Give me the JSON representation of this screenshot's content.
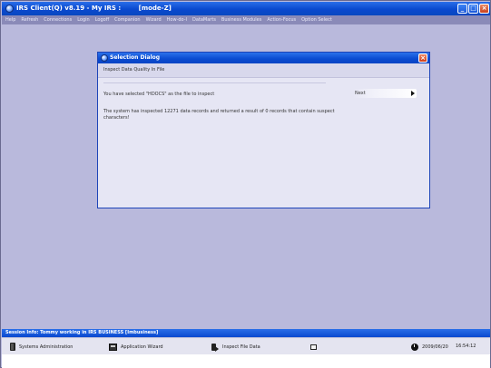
{
  "window": {
    "title": "IRS Client(Q) v8.19 - My IRS :        [mode-Z]",
    "minimize": "_",
    "maximize": "□",
    "close": "×"
  },
  "menu": {
    "items": [
      {
        "label": "Help"
      },
      {
        "label": "Refresh"
      },
      {
        "label": "Connections"
      },
      {
        "label": "Login"
      },
      {
        "label": "Logoff"
      },
      {
        "label": "Companion"
      },
      {
        "label": "Wizard"
      },
      {
        "label": "How-do-I"
      },
      {
        "label": "DataMarts"
      },
      {
        "label": "Business Modules"
      },
      {
        "label": "Action-Focus"
      },
      {
        "label": "Option Select"
      }
    ]
  },
  "dialog": {
    "title": "Selection Dialog",
    "close": "×",
    "heading": "Inspect Data Quality In File",
    "selected_text": "You have selected \"HDOCS\" as the file to inspect",
    "next_label": "Next",
    "result_text": "The system has inspected 12271 data records and returned a result of 0 records that contain suspect characters!"
  },
  "session": {
    "text": "Session Info: Tommy working in IRS BUSINESS  [Imbusiness]"
  },
  "status_bar": {
    "sysadmin_label": "Systems Administration",
    "wizard_label": "Application Wizard",
    "inspect_label": "Inspect File Data",
    "date": "2009/06/20",
    "time": "16:54:12"
  },
  "colors": {
    "title_bar": "#0a49cf",
    "workspace": "#b9b9dc",
    "dialog_bg": "#e6e6f4",
    "close_button": "#cf3e1a"
  },
  "icons": [
    "app-icon",
    "dialog-icon",
    "door-icon",
    "wizard-icon",
    "inspect-icon",
    "window-icon",
    "clock-icon",
    "arrow-right-icon"
  ]
}
